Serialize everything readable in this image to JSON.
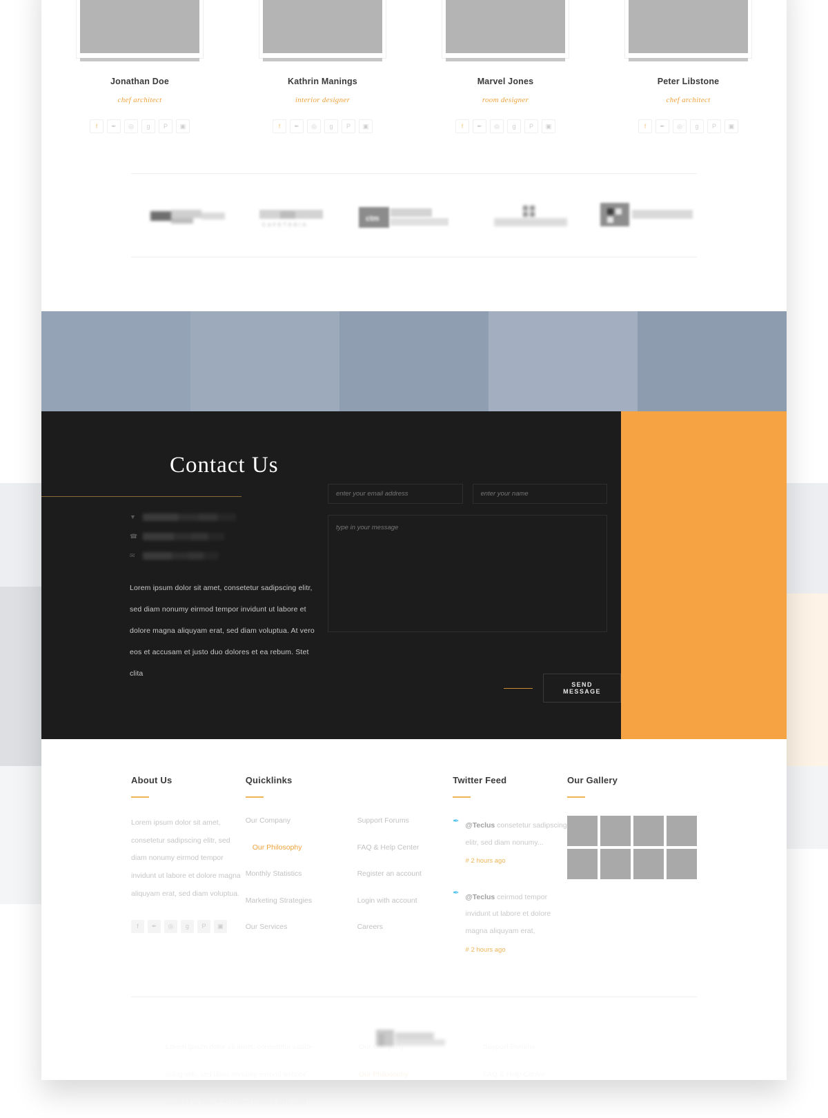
{
  "theme": {
    "accent_orange": "#f5a343",
    "accent_gold": "#f0a23c",
    "dark": "#1c1c1c",
    "blue_strip": [
      "#94a3b5",
      "#9aa8b9",
      "#909eb1",
      "#a2aec0",
      "#8e9caf"
    ]
  },
  "team": {
    "members": [
      {
        "name": "Jonathan Doe",
        "role": "chef architect"
      },
      {
        "name": "Kathrin Manings",
        "role": "interior designer"
      },
      {
        "name": "Marvel Jones",
        "role": "room designer"
      },
      {
        "name": "Peter Libstone",
        "role": "chef architect"
      }
    ],
    "socials": [
      {
        "icon": "facebook-icon",
        "glyph": "f"
      },
      {
        "icon": "twitter-icon",
        "glyph": "✒"
      },
      {
        "icon": "dribbble-icon",
        "glyph": "◎"
      },
      {
        "icon": "google-plus-icon",
        "glyph": "g"
      },
      {
        "icon": "pinterest-icon",
        "glyph": "P"
      },
      {
        "icon": "instagram-icon",
        "glyph": "▣"
      }
    ]
  },
  "clients": {
    "logos": [
      {
        "name": "client-logo-1",
        "caption": ""
      },
      {
        "name": "client-logo-2",
        "caption": "CAFETERIA"
      },
      {
        "name": "client-logo-3",
        "caption": "ctm"
      },
      {
        "name": "client-logo-4",
        "caption": ""
      },
      {
        "name": "client-logo-5",
        "caption": ""
      }
    ]
  },
  "contact": {
    "title": "Contact Us",
    "info_rows": [
      {
        "icon": "location-pin-icon",
        "glyph": "▼"
      },
      {
        "icon": "phone-icon",
        "glyph": "☎"
      },
      {
        "icon": "envelope-icon",
        "glyph": "✉"
      }
    ],
    "paragraph": "Lorem ipsum dolor sit amet, consetetur sadipscing elitr, sed diam nonumy eirmod tempor invidunt ut labore et dolore magna aliquyam erat, sed diam voluptua. At vero eos et accusam et justo duo dolores et ea rebum. Stet clita",
    "form": {
      "email_placeholder": "enter your email address",
      "name_placeholder": "enter your name",
      "message_placeholder": "type in your message",
      "submit_label": "SEND MESSAGE"
    }
  },
  "footer": {
    "about": {
      "heading": "About Us",
      "text": "Lorem ipsum dolor sit amet, consetetur sadipscing elitr, sed diam nonumy eirmod tempor invidunt ut labore et dolore magna aliquyam erat, sed diam voluptua.",
      "socials": [
        {
          "icon": "facebook-icon",
          "glyph": "f"
        },
        {
          "icon": "twitter-icon",
          "glyph": "✒"
        },
        {
          "icon": "dribbble-icon",
          "glyph": "◎"
        },
        {
          "icon": "google-plus-icon",
          "glyph": "g"
        },
        {
          "icon": "pinterest-icon",
          "glyph": "P"
        },
        {
          "icon": "instagram-icon",
          "glyph": "▣"
        }
      ]
    },
    "quicklinks": {
      "heading": "Quicklinks",
      "column1": [
        {
          "label": "Our Company",
          "active": false
        },
        {
          "label": "Our Philosophy",
          "active": true
        },
        {
          "label": "Monthly Statistics",
          "active": false
        },
        {
          "label": "Marketing Strategies",
          "active": false
        },
        {
          "label": "Our Services",
          "active": false
        }
      ],
      "column2": [
        {
          "label": "Support Forums",
          "active": false
        },
        {
          "label": "FAQ & Help Center",
          "active": false
        },
        {
          "label": "Register an account",
          "active": false
        },
        {
          "label": "Login with account",
          "active": false
        },
        {
          "label": "Careers",
          "active": false
        }
      ]
    },
    "twitter": {
      "heading": "Twitter Feed",
      "tweets": [
        {
          "handle": "@Teclus",
          "text": " consetetur sadipscing elitr, sed diam nonumy...",
          "time": "# 2 hours ago"
        },
        {
          "handle": "@Teclus",
          "text": " ceirmod tempor invidunt ut labore et dolore magna aliquyam erat,",
          "time": "# 2 hours ago"
        }
      ]
    },
    "gallery": {
      "heading": "Our Gallery",
      "cells": [
        "g1",
        "g2",
        "g3",
        "g4",
        "g5",
        "g6",
        "g7",
        "g8"
      ]
    }
  }
}
